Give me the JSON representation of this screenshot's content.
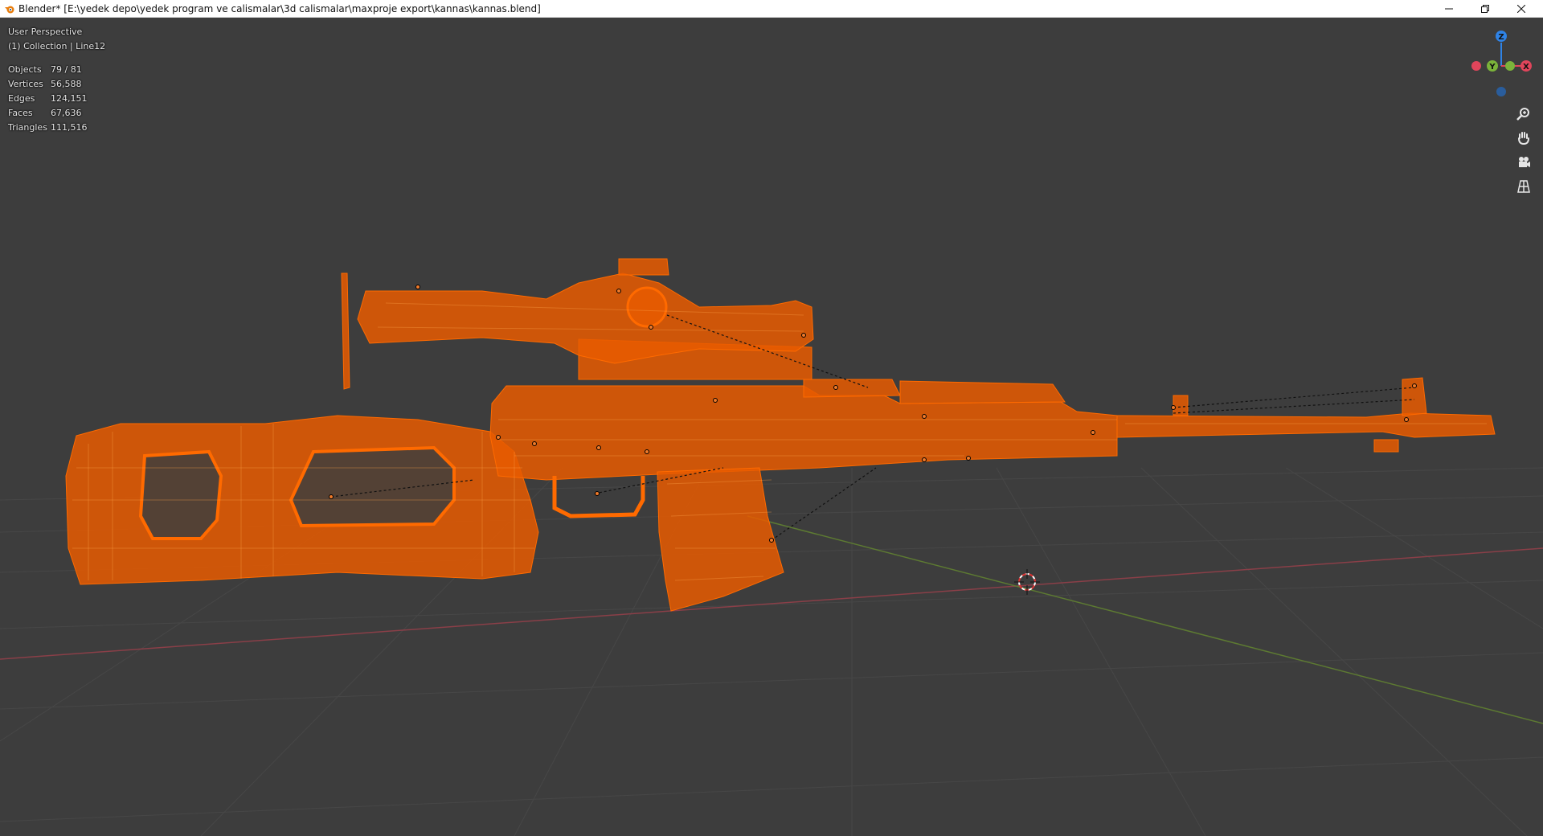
{
  "window": {
    "title": "Blender* [E:\\yedek depo\\yedek program ve calismalar\\3d calismalar\\maxproje export\\kannas\\kannas.blend]",
    "controls": [
      "minimize",
      "restore",
      "close"
    ]
  },
  "viewport": {
    "view_name": "User Perspective",
    "collection_label": "(1) Collection | Line12",
    "stats": [
      {
        "label": "Objects",
        "value": "79 / 81"
      },
      {
        "label": "Vertices",
        "value": "56,588"
      },
      {
        "label": "Edges",
        "value": "124,151"
      },
      {
        "label": "Faces",
        "value": "67,636"
      },
      {
        "label": "Triangles",
        "value": "111,516"
      }
    ],
    "gizmo": {
      "axes": [
        {
          "label": "Z",
          "color": "#2f83e6"
        },
        {
          "label": "Y",
          "color": "#7bb33a"
        },
        {
          "label": "X",
          "color": "#e0455b"
        }
      ]
    },
    "nav_buttons": [
      {
        "name": "zoom",
        "icon": "zoom-icon"
      },
      {
        "name": "pan",
        "icon": "hand-icon"
      },
      {
        "name": "camera",
        "icon": "camera-icon"
      },
      {
        "name": "ortho",
        "icon": "grid-icon"
      }
    ],
    "colors": {
      "background": "#3d3d3d",
      "grid": "#4a4a4a",
      "x_axis": "#8a3f48",
      "y_axis": "#5d7a32",
      "wire_selected": "#ff6a00"
    }
  }
}
